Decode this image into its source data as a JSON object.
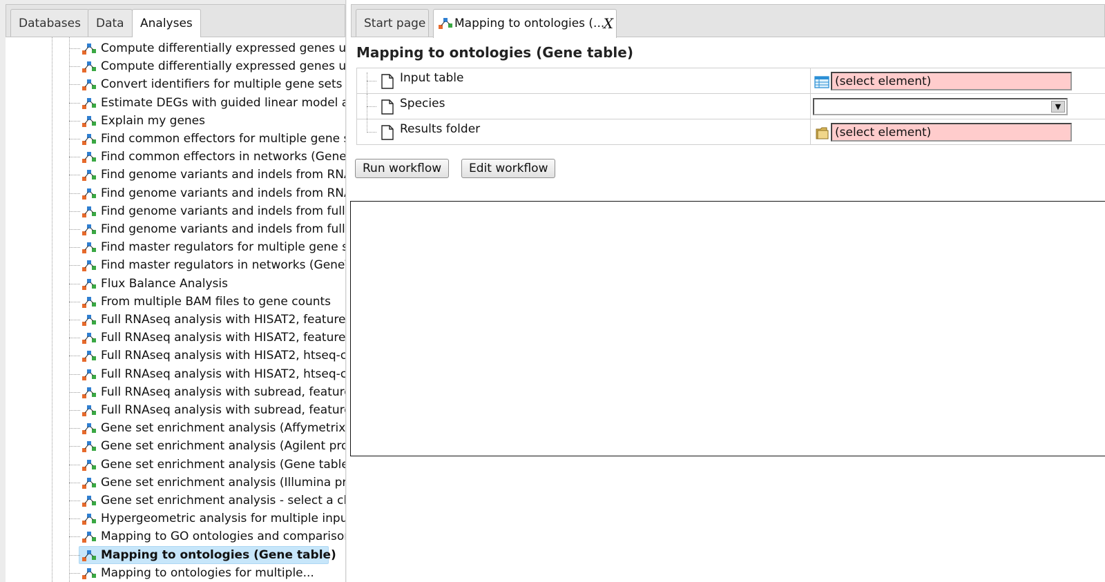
{
  "left_tabs": [
    {
      "label": "Databases",
      "active": false
    },
    {
      "label": "Data",
      "active": false
    },
    {
      "label": "Analyses",
      "active": true
    }
  ],
  "tree": {
    "items": [
      {
        "label": "Compute differentially expressed genes us",
        "icon": "workflow-icon"
      },
      {
        "label": "Compute differentially expressed genes us",
        "icon": "workflow-icon"
      },
      {
        "label": "Convert identifiers for multiple gene sets",
        "icon": "workflow-icon"
      },
      {
        "label": "Estimate DEGs with guided linear model a",
        "icon": "workflow-icon"
      },
      {
        "label": "Explain my genes",
        "icon": "workflow-icon"
      },
      {
        "label": "Find common effectors for multiple gene s",
        "icon": "workflow-icon"
      },
      {
        "label": "Find common effectors in networks (Gene\\",
        "icon": "workflow-icon"
      },
      {
        "label": "Find genome variants and indels from RNA",
        "icon": "workflow-icon"
      },
      {
        "label": "Find genome variants and indels from RNA",
        "icon": "workflow-icon"
      },
      {
        "label": "Find genome variants and indels from full-",
        "icon": "workflow-icon"
      },
      {
        "label": "Find genome variants and indels from full-",
        "icon": "workflow-icon"
      },
      {
        "label": "Find master regulators for multiple gene s",
        "icon": "workflow-icon"
      },
      {
        "label": "Find master regulators in networks (Gene\\",
        "icon": "workflow-icon"
      },
      {
        "label": "Flux Balance Analysis",
        "icon": "workflow-icon"
      },
      {
        "label": "From multiple BAM files to gene counts",
        "icon": "workflow-icon"
      },
      {
        "label": "Full RNAseq analysis with HISAT2, feature",
        "icon": "workflow-icon"
      },
      {
        "label": "Full RNAseq analysis with HISAT2, feature",
        "icon": "workflow-icon"
      },
      {
        "label": "Full RNAseq analysis with HISAT2, htseq-c",
        "icon": "workflow-icon"
      },
      {
        "label": "Full RNAseq analysis with HISAT2, htseq-c",
        "icon": "workflow-icon"
      },
      {
        "label": "Full RNAseq analysis with subread, feature",
        "icon": "workflow-icon"
      },
      {
        "label": "Full RNAseq analysis with subread, feature",
        "icon": "workflow-icon"
      },
      {
        "label": "Gene set enrichment analysis (Affymetrix",
        "icon": "workflow-icon"
      },
      {
        "label": "Gene set enrichment analysis (Agilent pro",
        "icon": "workflow-icon"
      },
      {
        "label": "Gene set enrichment analysis (Gene table)",
        "icon": "workflow-icon"
      },
      {
        "label": "Gene set enrichment analysis (Illumina pr",
        "icon": "workflow-icon"
      },
      {
        "label": "Gene set enrichment analysis - select a cla",
        "icon": "workflow-icon"
      },
      {
        "label": "Hypergeometric analysis for multiple input",
        "icon": "workflow-icon"
      },
      {
        "label": "Mapping to GO ontologies and comparison",
        "icon": "workflow-icon"
      },
      {
        "label": "Mapping to ontologies (Gene table)",
        "icon": "workflow-icon",
        "selected": true
      },
      {
        "label": "Mapping to ontologies for multiple...",
        "icon": "workflow-icon"
      }
    ]
  },
  "doc_tabs": [
    {
      "label": "Start page",
      "active": false
    },
    {
      "label": "Mapping to ontologies (...",
      "active": true,
      "icon": "workflow-icon",
      "close": "X"
    }
  ],
  "main": {
    "title": "Mapping to ontologies (Gene table)",
    "params": [
      {
        "label": "Input table",
        "type_icon": "table-icon",
        "value": "(select element)",
        "kind": "element"
      },
      {
        "label": "Species",
        "type_icon": "",
        "value": "",
        "kind": "dropdown"
      },
      {
        "label": "Results folder",
        "type_icon": "folder-icon",
        "value": "(select element)",
        "kind": "element"
      }
    ],
    "buttons": {
      "run": "Run workflow",
      "edit": "Edit workflow"
    }
  },
  "colors": {
    "required_field_bg": "#ffcccc",
    "selection_bg": "#c7e6fa"
  }
}
